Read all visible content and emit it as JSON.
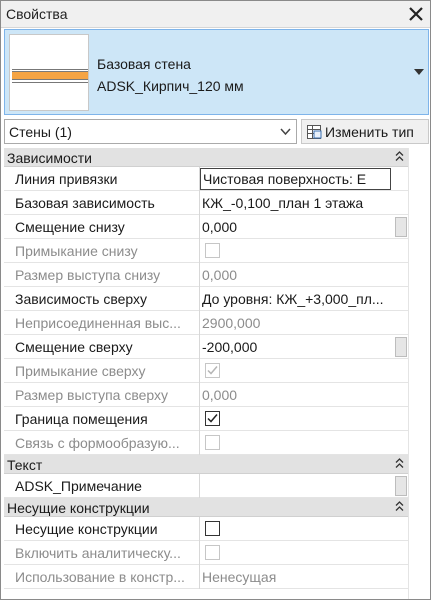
{
  "panel": {
    "title": "Свойства",
    "close_icon": "close-icon"
  },
  "type_selector": {
    "family": "Базовая стена",
    "type_name": "ADSK_Кирпич_120 мм",
    "accent": "#cde6f7",
    "preview_fill": "#f5a444"
  },
  "filter": {
    "label": "Стены (1)"
  },
  "edit_type": {
    "label": "Изменить тип",
    "icon": "edit-type-icon"
  },
  "groups": [
    {
      "name": "Зависимости",
      "rows": [
        {
          "name": "Линия привязки",
          "value": "Чистовая поверхность: Е",
          "kind": "edit",
          "readonly": false
        },
        {
          "name": "Базовая зависимость",
          "value": "КЖ_-0,100_план 1 этажа",
          "kind": "text",
          "readonly": false
        },
        {
          "name": "Смещение снизу",
          "value": "0,000",
          "kind": "text",
          "readonly": false,
          "button": true
        },
        {
          "name": "Примыкание снизу",
          "value": "",
          "kind": "checkbox",
          "checked": false,
          "readonly": true
        },
        {
          "name": "Размер выступа снизу",
          "value": "0,000",
          "kind": "text",
          "readonly": true
        },
        {
          "name": "Зависимость сверху",
          "value": "До уровня: КЖ_+3,000_пл...",
          "kind": "text",
          "readonly": false
        },
        {
          "name": "Неприсоединенная выс...",
          "value": "2900,000",
          "kind": "text",
          "readonly": true
        },
        {
          "name": "Смещение сверху",
          "value": "-200,000",
          "kind": "text",
          "readonly": false,
          "button": true
        },
        {
          "name": "Примыкание сверху",
          "value": "",
          "kind": "checkbox",
          "checked": true,
          "readonly": true
        },
        {
          "name": "Размер выступа сверху",
          "value": "0,000",
          "kind": "text",
          "readonly": true
        },
        {
          "name": "Граница помещения",
          "value": "",
          "kind": "checkbox",
          "checked": true,
          "readonly": false
        },
        {
          "name": "Связь с формообразую...",
          "value": "",
          "kind": "checkbox",
          "checked": false,
          "readonly": true
        }
      ]
    },
    {
      "name": "Текст",
      "rows": [
        {
          "name": "ADSK_Примечание",
          "value": "",
          "kind": "text",
          "readonly": false,
          "button": true
        }
      ]
    },
    {
      "name": "Несущие конструкции",
      "rows": [
        {
          "name": "Несущие конструкции",
          "value": "",
          "kind": "checkbox",
          "checked": false,
          "readonly": false
        },
        {
          "name": "Включить аналитическу...",
          "value": "",
          "kind": "checkbox",
          "checked": false,
          "readonly": true
        },
        {
          "name": "Использование в констр...",
          "value": "Ненесущая",
          "kind": "text",
          "readonly": true
        }
      ]
    }
  ]
}
